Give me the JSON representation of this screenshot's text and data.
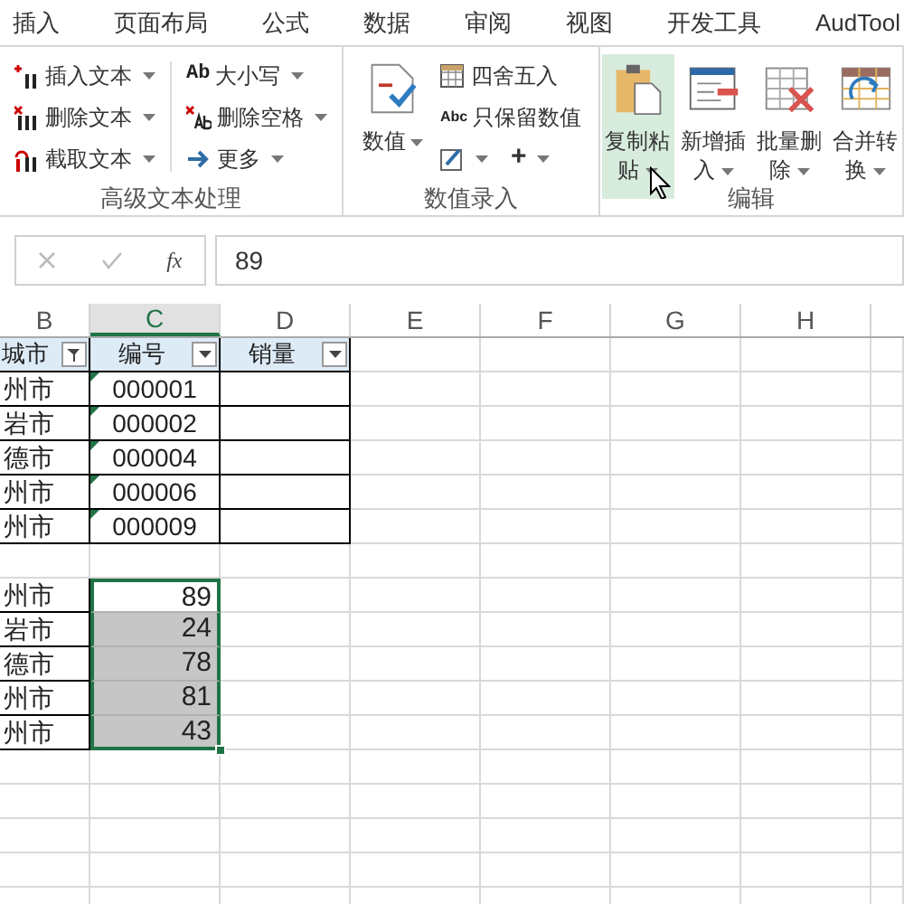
{
  "tabs": [
    "插入",
    "页面布局",
    "公式",
    "数据",
    "审阅",
    "视图",
    "开发工具",
    "AudTool"
  ],
  "ribbon_groups": [
    {
      "title": "高级文本处理",
      "items": [
        {
          "kind": "small",
          "label": "插入文本"
        },
        {
          "kind": "small",
          "label": "删除文本"
        },
        {
          "kind": "small",
          "label": "截取文本"
        },
        {
          "kind": "small",
          "label": "大小写",
          "icon_text": "Ab"
        },
        {
          "kind": "small",
          "label": "删除空格"
        },
        {
          "kind": "small",
          "label": "更多"
        }
      ]
    },
    {
      "title": "数值录入",
      "items": [
        {
          "kind": "large",
          "label": "数值",
          "hovered": false
        },
        {
          "kind": "small",
          "label": "四舍五入"
        },
        {
          "kind": "small",
          "label": "只保留数值",
          "icon_text": "Abc"
        },
        {
          "kind": "small"
        },
        {
          "kind": "small",
          "label": "+"
        }
      ]
    },
    {
      "title": "编辑",
      "items": [
        {
          "kind": "large",
          "label": "复制粘贴",
          "hovered": true
        },
        {
          "kind": "large",
          "label": "新增插入",
          "hovered": false
        },
        {
          "kind": "large",
          "label": "批量删除",
          "hovered": false
        },
        {
          "kind": "large",
          "label": "合并转换",
          "hovered": false
        }
      ]
    }
  ],
  "formula_bar": {
    "function_label": "fx",
    "value": "89"
  },
  "columns": [
    {
      "label": "B",
      "selected": false
    },
    {
      "label": "C",
      "selected": true
    },
    {
      "label": "D",
      "selected": false
    },
    {
      "label": "E",
      "selected": false
    },
    {
      "label": "F",
      "selected": false
    },
    {
      "label": "G",
      "selected": false
    },
    {
      "label": "H",
      "selected": false
    }
  ],
  "table": {
    "headers": [
      {
        "label": "城市",
        "filtered": true
      },
      {
        "label": "编号",
        "filtered": false
      },
      {
        "label": "销量",
        "filtered": false
      }
    ],
    "rows": [
      {
        "city": "州市",
        "code": "000001"
      },
      {
        "city": "岩市",
        "code": "000002"
      },
      {
        "city": "德市",
        "code": "000004"
      },
      {
        "city": "州市",
        "code": "000006"
      },
      {
        "city": "州市",
        "code": "000009"
      }
    ]
  },
  "selection_table": {
    "rows": [
      {
        "city": "州市",
        "value": "89",
        "selected": false
      },
      {
        "city": "岩市",
        "value": "24",
        "selected": true
      },
      {
        "city": "德市",
        "value": "78",
        "selected": true
      },
      {
        "city": "州市",
        "value": "81",
        "selected": true
      },
      {
        "city": "州市",
        "value": "43",
        "selected": true
      }
    ]
  }
}
